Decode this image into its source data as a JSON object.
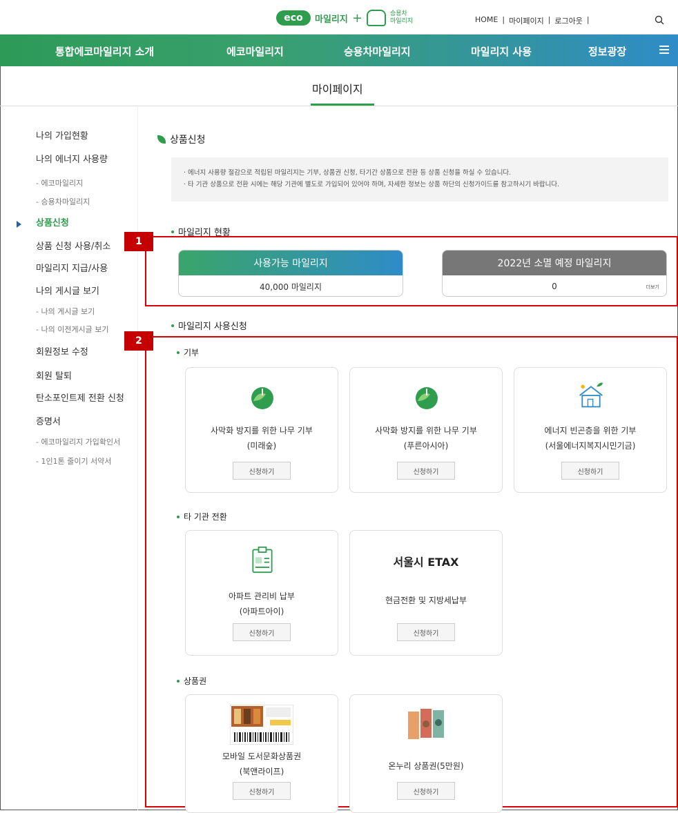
{
  "header": {
    "logo_eco": "eco",
    "logo_mileage": "마일리지",
    "logo_plus": "+",
    "logo_car_line1": "승용차",
    "logo_car_line2": "마일리지",
    "links": [
      "HOME",
      "|",
      "마이페이지",
      "|",
      "로그아웃",
      "|"
    ]
  },
  "nav": {
    "items": [
      "통합에코마일리지 소개",
      "에코마일리지",
      "승용차마일리지",
      "마일리지 사용",
      "정보광장"
    ]
  },
  "subhead": {
    "title": "마이페이지"
  },
  "sidebar": {
    "items": [
      {
        "label": "나의 가입현황",
        "sub": false,
        "active": false
      },
      {
        "label": "나의 에너지 사용량",
        "sub": false,
        "active": false
      },
      {
        "label": "- 에코마일리지",
        "sub": true,
        "active": false
      },
      {
        "label": "- 승용차마일리지",
        "sub": true,
        "active": false
      },
      {
        "label": "상품신청",
        "sub": false,
        "active": true
      },
      {
        "label": "상품 신청 사용/취소",
        "sub": false,
        "active": false
      },
      {
        "label": "마일리지 지급/사용",
        "sub": false,
        "active": false
      },
      {
        "label": "나의 게시글 보기",
        "sub": false,
        "active": false
      },
      {
        "label": "- 나의 게시글 보기",
        "sub": true,
        "active": false
      },
      {
        "label": "- 나의 이전게시글 보기",
        "sub": true,
        "active": false
      },
      {
        "label": "회원정보 수정",
        "sub": false,
        "active": false
      },
      {
        "label": "회원 탈퇴",
        "sub": false,
        "active": false
      },
      {
        "label": "탄소포인트제 전환 신청",
        "sub": false,
        "active": false
      },
      {
        "label": "증명서",
        "sub": false,
        "active": false
      },
      {
        "label": "- 에코마일리지 가입확인서",
        "sub": true,
        "active": false
      },
      {
        "label": "- 1인1톤 줄이기 서약서",
        "sub": true,
        "active": false
      }
    ]
  },
  "main": {
    "page_title": "상품신청",
    "info_lines": [
      "· 에너지 사용량 절감으로 적립된 마일리지는 기부, 상품권 신청, 타기간 상품으로 전환 등 상품 신청을 하실 수 있습니다.",
      "· 타 기관 상품으로 전환 시에는 해당 기관에 별도로 가입되어 있어야 하며, 자세한 정보는 상품 하단의 신청가이드를 참고하시기 바랍니다."
    ],
    "status_title": "마일리지 현황",
    "available_label": "사용가능 마일리지",
    "available_value": "40,000 마일리지",
    "expire_label": "2022년 소멸 예정 마일리지",
    "expire_value": "0",
    "more_label": "더보기",
    "apply_title": "마일리지 사용신청",
    "badge1": "1",
    "badge2": "2",
    "donation_title": "기부",
    "transfer_title": "타 기관 전환",
    "voucher_title": "상품권",
    "apply_button": "신청하기",
    "donation_cards": [
      {
        "line1": "사막화 방지를 위한 나무 기부",
        "line2": "(미래숲)"
      },
      {
        "line1": "사막화 방지를 위한 나무 기부",
        "line2": "(푸른아시아)"
      },
      {
        "line1": "에너지 빈곤층을 위한 기부",
        "line2": "(서울에너지복지시민기금)"
      }
    ],
    "transfer_cards": [
      {
        "line1": "아파트 관리비 납부",
        "line2": "(아파트아이)"
      },
      {
        "title": "서울시 ETAX",
        "line1": "현금전환 및 지방세납부"
      }
    ],
    "voucher_cards": [
      {
        "line1": "모바일 도서문화상품권",
        "line2": "(북앤라이프)"
      },
      {
        "line1": "온누리 상품권(5만원)"
      }
    ]
  },
  "colors": {
    "green": "#2e9d4e",
    "blue": "#2f8cc7",
    "red": "#d60000",
    "gray": "#777777"
  }
}
